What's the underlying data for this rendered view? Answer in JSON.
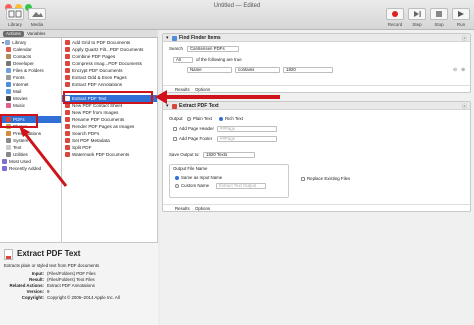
{
  "window": {
    "title": "Untitled — Edited"
  },
  "toolbar": {
    "left": [
      {
        "label": "Library",
        "icon": "library-icon"
      },
      {
        "label": "Media",
        "icon": "media-icon"
      }
    ],
    "right": [
      {
        "label": "Record",
        "icon": "record-icon"
      },
      {
        "label": "Step",
        "icon": "step-icon"
      },
      {
        "label": "Stop",
        "icon": "stop-icon"
      },
      {
        "label": "Run",
        "icon": "run-icon"
      }
    ]
  },
  "tabs": {
    "actions": "Actions",
    "variables": "Variables"
  },
  "library": {
    "root": "Library",
    "items": [
      "Calendar",
      "Contacts",
      "Developer",
      "Files & Folders",
      "Fonts",
      "Internet",
      "Mail",
      "Movies",
      "Music",
      "PDFs",
      "Photos",
      "Presentations",
      "System",
      "Text",
      "Utilities",
      "Most Used",
      "Recently Added"
    ],
    "selected": "PDFs"
  },
  "actions": {
    "items": [
      "Add Grid to PDF Documents",
      "Apply Quartz Filt...PDF Documents",
      "Combine PDF Pages",
      "Compress Imag...PDF Documents",
      "Encrypt PDF Documents",
      "Extract Odd & Even Pages",
      "Extract PDF Annotations",
      "Extract PDF Text",
      "New PDF Contact Sheet",
      "New PDF from Images",
      "Rename PDF Documents",
      "Render PDF Pages as Images",
      "Search PDFs",
      "Set PDF Metadata",
      "Split PDF",
      "Watermark PDF Documents"
    ],
    "selected": "Extract PDF Text"
  },
  "info": {
    "title": "Extract PDF Text",
    "description": "Extracts plain or styled text from PDF documents",
    "fields": [
      {
        "key": "Input:",
        "value": "(Files/Folders) PDF Files"
      },
      {
        "key": "Result:",
        "value": "(Files/Folders) Text Files"
      },
      {
        "key": "Related Actions:",
        "value": "Extract PDF Annotations"
      },
      {
        "key": "Version:",
        "value": "9"
      },
      {
        "key": "Copyright:",
        "value": "Copyright © 2006–2014 Apple Inc. All"
      }
    ]
  },
  "finder_card": {
    "title": "Find Finder Items",
    "search_label": "Search",
    "search_value": "Carstensen PDFs",
    "match_value": "All",
    "match_text": "of the following are true",
    "criteria_field": "Name",
    "criteria_op": "contains",
    "criteria_value": "1820",
    "results_tab": "Results",
    "options_tab": "Options"
  },
  "extract_card": {
    "title": "Extract PDF Text",
    "output_label": "Output:",
    "plain_text": "Plain Text",
    "rich_text": "Rich Text",
    "add_page_header": "Add Page Header",
    "add_page_footer": "Add Page Footer",
    "header_placeholder": "##Page",
    "footer_placeholder": "##Page",
    "save_output_label": "Save Output to:",
    "save_output_value": "1820 Texts",
    "output_file_name_label": "Output File Name",
    "same_as_input": "Same as Input Name",
    "custom_name": "Custom Name",
    "custom_placeholder": "Extract Text Output",
    "replace_existing": "Replace Existing Files",
    "results_tab": "Results",
    "options_tab": "Options"
  },
  "colors": {
    "accent": "#2f6fd6",
    "annotation": "#d0121b"
  }
}
